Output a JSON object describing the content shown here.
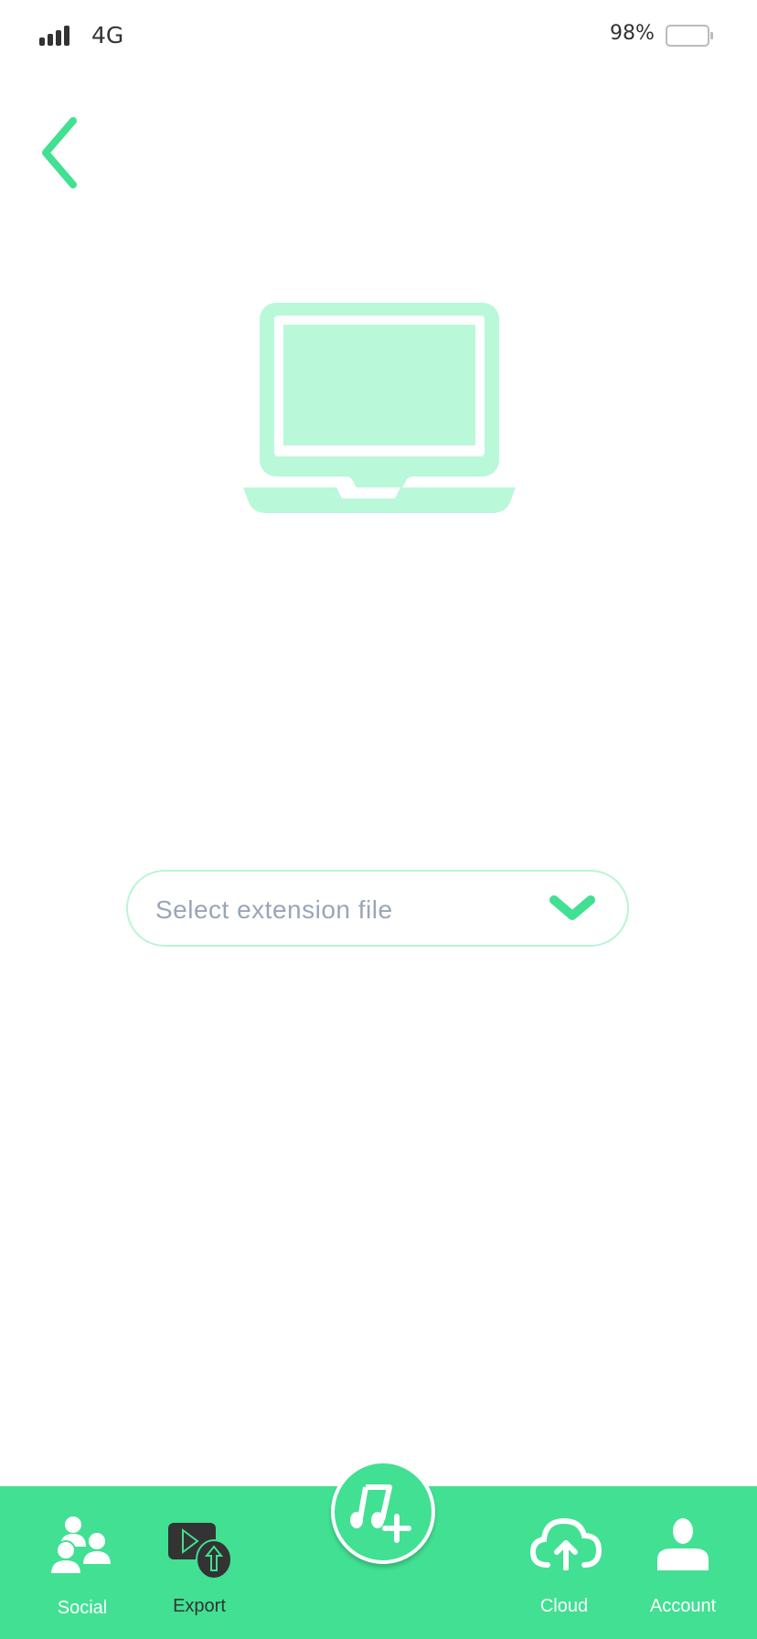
{
  "status_bar": {
    "network": "4G",
    "battery_percent": "98%",
    "signal_icon": "signal-bars-icon",
    "battery_icon": "battery-icon"
  },
  "header": {
    "back_icon": "chevron-left-icon"
  },
  "hero": {
    "icon": "laptop-icon"
  },
  "file_select": {
    "placeholder": "Select extension file",
    "icon": "chevron-down-icon"
  },
  "tab_bar": {
    "items": [
      {
        "label": "Social",
        "icon": "people-icon"
      },
      {
        "label": "Export",
        "icon": "export-video-icon"
      },
      {
        "label": "",
        "icon": "add-music-icon"
      },
      {
        "label": "Cloud",
        "icon": "cloud-upload-icon"
      },
      {
        "label": "Account",
        "icon": "user-icon"
      }
    ]
  },
  "colors": {
    "accent": "#41e092",
    "accent_light": "#b9f8d9",
    "placeholder_text": "#9aa5b8",
    "dark_text": "#333333"
  }
}
